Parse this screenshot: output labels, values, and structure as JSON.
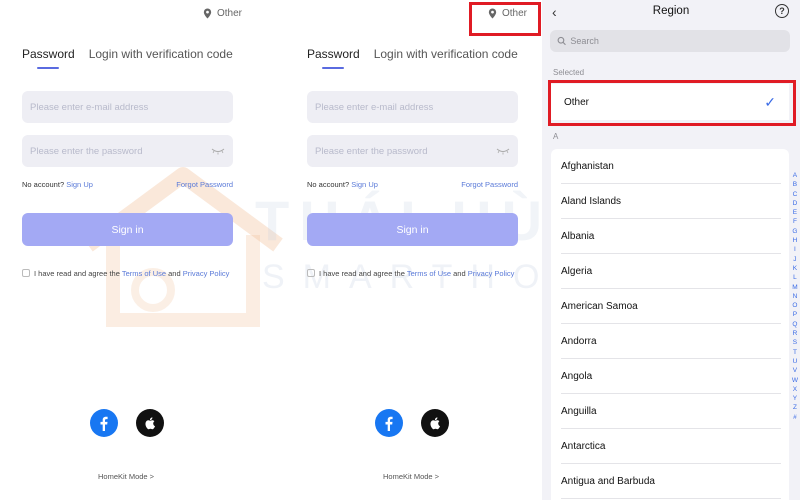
{
  "watermark": {
    "brand": "THÁI HÙNG",
    "tagline": "SMARTHOME"
  },
  "login": {
    "region_label": "Other",
    "tabs": [
      "Password",
      "Login with verification code"
    ],
    "email_placeholder": "Please enter e-mail address",
    "password_placeholder": "Please enter the password",
    "no_account": "No account?",
    "sign_up": "Sign Up",
    "forgot": "Forgot Password",
    "sign_in": "Sign in",
    "agree_prefix": "I have read and agree the",
    "terms": "Terms of Use",
    "and": "and",
    "privacy": "Privacy Policy",
    "homekit": "HomeKit Mode >"
  },
  "region": {
    "back": "‹",
    "title": "Region",
    "help": "?",
    "search_placeholder": "Search",
    "selected_label": "Selected",
    "selected_value": "Other",
    "check": "✓",
    "section_a": "A",
    "countries": [
      "Afghanistan",
      "Aland Islands",
      "Albania",
      "Algeria",
      "American Samoa",
      "Andorra",
      "Angola",
      "Anguilla",
      "Antarctica",
      "Antigua and Barbuda"
    ],
    "alphabet": [
      "A",
      "B",
      "C",
      "D",
      "E",
      "F",
      "G",
      "H",
      "I",
      "J",
      "K",
      "L",
      "M",
      "N",
      "O",
      "P",
      "Q",
      "R",
      "S",
      "T",
      "U",
      "V",
      "W",
      "X",
      "Y",
      "Z",
      "#"
    ]
  },
  "colors": {
    "accent": "#5a6be0",
    "signin_button": "#a3a9f4",
    "highlight": "#e01b24",
    "check": "#3a6be6"
  }
}
